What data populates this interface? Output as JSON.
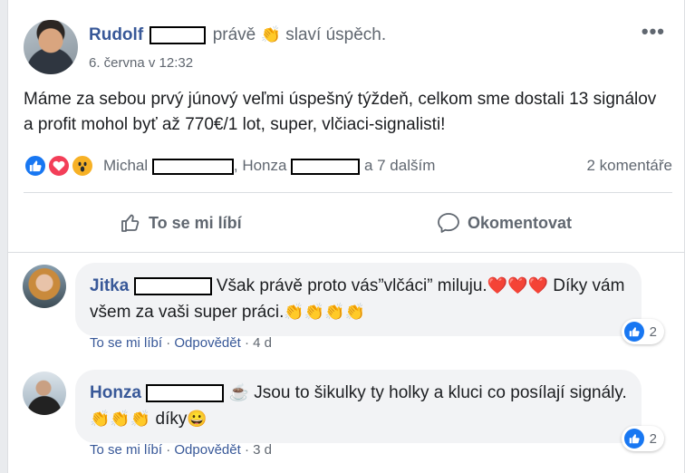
{
  "post": {
    "author": "Rudolf",
    "action_prefix": "právě",
    "action_emoji": "👏",
    "action_text": "slaví úspěch.",
    "time": "6. června v 12:32",
    "more_icon": "•••",
    "text": "Máme za sebou prvý júnový veľmi úspešný týždeň, celkom sme dostali 13 signálov a profit mohol byť až 770€/1 lot, super, vlčiaci-signalisti!"
  },
  "reactions": {
    "icons": [
      "like-icon",
      "love-icon",
      "wow-icon"
    ],
    "name1": "Michal",
    "sep": ",",
    "name2": "Honza",
    "others": "a 7 dalším",
    "comment_count": "2 komentáře"
  },
  "actions": {
    "like_label": "To se mi líbí",
    "comment_label": "Okomentovat"
  },
  "comments": [
    {
      "author": "Jitka",
      "text1": "Však právě proto vás”vlčáci” miluju.",
      "hearts": "❤️❤️❤️",
      "text2": "Díky vám všem za vaši super práci.",
      "claps": "👏👏👏👏",
      "like_label": "To se mi líbí",
      "dot": "·",
      "reply_label": "Odpovědět",
      "age": "4 d",
      "reaction_count": "2"
    },
    {
      "author": "Honza",
      "cup": "☕",
      "text1": "Jsou to šikulky ty holky a kluci co posílají signály.",
      "claps": "👏👏👏",
      "text2": "díky",
      "smile": "😀",
      "like_label": "To se mi líbí",
      "dot": "·",
      "reply_label": "Odpovědět",
      "age": "3 d",
      "reaction_count": "2"
    }
  ],
  "colors": {
    "link": "#385898",
    "muted": "#606770",
    "like": "#1877f2",
    "love": "#f33e58",
    "wow": "#f7b125",
    "bubble": "#f2f3f5"
  }
}
